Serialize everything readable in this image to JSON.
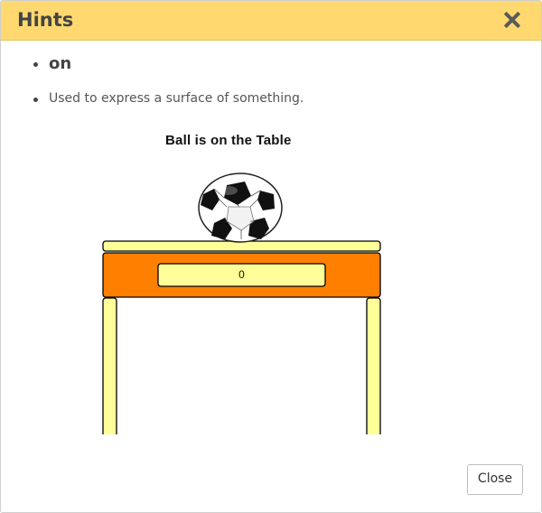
{
  "dialog": {
    "title": "Hints",
    "close_button_label": "Close"
  },
  "hint": {
    "word": "on",
    "description": "Used to express a surface of something."
  },
  "illustration": {
    "caption": "Ball is on the Table",
    "drawer_label": "0",
    "colors": {
      "table_top": "#ffff99",
      "table_body": "#ff7f00",
      "table_legs": "#ffff99",
      "header": "#ffd970"
    }
  }
}
